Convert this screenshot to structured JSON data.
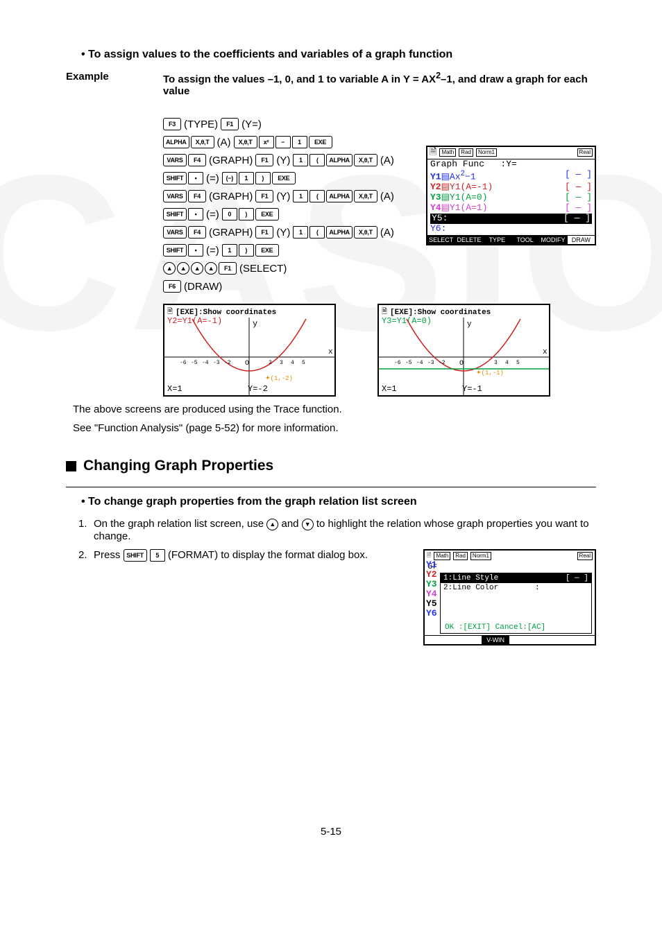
{
  "heading1": "To assign values to the coefficients and variables of a graph function",
  "example_label": "Example",
  "example_text_1": "To assign the values –1, 0, and 1 to variable A in Y = AX",
  "example_text_sup": "2",
  "example_text_2": "–1, and draw a graph for each value",
  "keyrows": {
    "r1": {
      "k1": "F3",
      "p1": "(TYPE)",
      "k2": "F1",
      "p2": "(Y=)"
    },
    "r2": {
      "k1": "ALPHA",
      "k2": "X,θ,T",
      "p1": "(A)",
      "k3": "X,θ,T",
      "k4": "x²",
      "k5": "−",
      "k6": "1",
      "k7": "EXE"
    },
    "r3": {
      "k1": "VARS",
      "k2": "F4",
      "p1": "(GRAPH)",
      "k3": "F1",
      "p2": "(Y)",
      "k4": "1",
      "k5": "(",
      "k6": "ALPHA",
      "k7": "X,θ,T",
      "p3": "(A)"
    },
    "r4": {
      "k1": "SHIFT",
      "k2": "•",
      "p1": "(=)",
      "k3": "(−)",
      "k4": "1",
      "k5": ")",
      "k6": "EXE"
    },
    "r5": {
      "k1": "VARS",
      "k2": "F4",
      "p1": "(GRAPH)",
      "k3": "F1",
      "p2": "(Y)",
      "k4": "1",
      "k5": "(",
      "k6": "ALPHA",
      "k7": "X,θ,T",
      "p3": "(A)"
    },
    "r6": {
      "k1": "SHIFT",
      "k2": "•",
      "p1": "(=)",
      "k3": "0",
      "k4": ")",
      "k5": "EXE"
    },
    "r7": {
      "k1": "VARS",
      "k2": "F4",
      "p1": "(GRAPH)",
      "k3": "F1",
      "p2": "(Y)",
      "k4": "1",
      "k5": "(",
      "k6": "ALPHA",
      "k7": "X,θ,T",
      "p3": "(A)"
    },
    "r8": {
      "k1": "SHIFT",
      "k2": "•",
      "p1": "(=)",
      "k3": "1",
      "k4": ")",
      "k5": "EXE"
    },
    "r9": {
      "k1": "▲",
      "k2": "▲",
      "k3": "▲",
      "k4": "▲",
      "k5": "F1",
      "p1": "(SELECT)"
    },
    "r10": {
      "k1": "F6",
      "p1": "(DRAW)"
    }
  },
  "calc1": {
    "badges": [
      "Math",
      "Rad",
      "Norm1",
      "Real"
    ],
    "title": "Graph Func   :Y=",
    "y1a": "Y1",
    "y1b": "Ax",
    "y1sup": "2",
    "y1c": "−1",
    "y2": "Y2",
    "y2b": "Y1(A=-1)",
    "y3": "Y3",
    "y3b": "Y1(A=0)",
    "y4": "Y4",
    "y4b": "Y1(A=1)",
    "y5": "Y5:",
    "y6": "Y6:",
    "bracket": "[ ― ]",
    "soft": [
      "SELECT",
      "DELETE",
      "TYPE",
      "TOOL",
      "MODIFY",
      "DRAW"
    ]
  },
  "graphA": {
    "exe": "[EXE]:Show coordinates",
    "eq": "Y2=Y1(A=-1)",
    "ylab": "y",
    "ann": "(1,-2)",
    "xbot": "X=1",
    "ybot": "Y=-2"
  },
  "graphB": {
    "exe": "[EXE]:Show coordinates",
    "eq": "Y3=Y1(A=0)",
    "ylab": "y",
    "ann": "(1,-1)",
    "xbot": "X=1",
    "ybot": "Y=-1"
  },
  "note1": "The above screens are produced using the Trace function.",
  "note2": "See \"Function Analysis\" (page 5-52) for more information.",
  "section2": "Changing Graph Properties",
  "bullet2": "To change graph properties from the graph relation list screen",
  "step1_num": "1.",
  "step1a": "On the graph relation list screen, use ",
  "step1b": " and ",
  "step1c": " to highlight the relation whose graph properties you want to change.",
  "step2_num": "2.",
  "step2a": "Press ",
  "step2_key1": "SHIFT",
  "step2_key2": "5",
  "step2b": "(FORMAT) to display the format dialog box.",
  "fmt": {
    "badges": [
      "Math",
      "Rad",
      "Norm1",
      "Real"
    ],
    "head": "Graph Func   :Y=",
    "ys": [
      "Y1",
      "Y2",
      "Y3",
      "Y4",
      "Y5",
      "Y6"
    ],
    "opt1": "1:Line Style",
    "opt1r": "[ ― ]",
    "opt2": "2:Line Color        :",
    "ok": "OK :[EXIT]  Cancel:[AC]",
    "bottom": "V-WIN"
  },
  "pagenum": "5-15"
}
